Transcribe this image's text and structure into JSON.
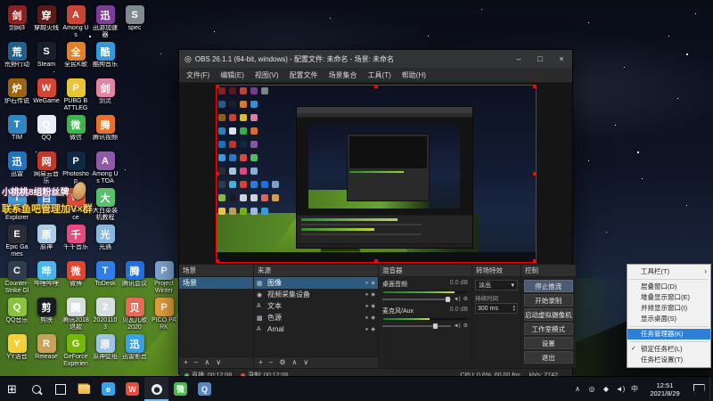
{
  "desktop": {
    "overlays": {
      "fan_badge": "小桃桃8组粉丝牌",
      "contact": "联系鱼吧管理加V×群"
    },
    "icons": [
      {
        "label": "剑网3",
        "color": "#8e2020",
        "col": 0,
        "row": 0
      },
      {
        "label": "穿越火线",
        "color": "#5b1a1a",
        "col": 1,
        "row": 0
      },
      {
        "label": "Among Us",
        "color": "#c74634",
        "col": 2,
        "row": 0
      },
      {
        "label": "迅游加速器",
        "color": "#7d3c98",
        "col": 3,
        "row": 0
      },
      {
        "label": "spec",
        "color": "#7f8c8d",
        "col": 4,
        "row": 0
      },
      {
        "label": "荒野行动",
        "color": "#1f618d",
        "col": 0,
        "row": 1
      },
      {
        "label": "Steam",
        "color": "#17202a",
        "col": 1,
        "row": 1
      },
      {
        "label": "全民K歌",
        "color": "#e67e22",
        "col": 2,
        "row": 1
      },
      {
        "label": "酷狗音乐",
        "color": "#3498db",
        "col": 3,
        "row": 1
      },
      {
        "label": "炉石传说",
        "color": "#9c640c",
        "col": 0,
        "row": 2
      },
      {
        "label": "WeGame",
        "color": "#d64533",
        "col": 1,
        "row": 2
      },
      {
        "label": "PUBG BATTLEGROUNDS",
        "color": "#e8c531",
        "col": 2,
        "row": 2
      },
      {
        "label": "剑灵",
        "color": "#e584a2",
        "col": 3,
        "row": 2
      },
      {
        "label": "TIM",
        "color": "#2e86c1",
        "col": 0,
        "row": 3
      },
      {
        "label": "QQ",
        "color": "#e8eef5",
        "col": 1,
        "row": 3
      },
      {
        "label": "微信",
        "color": "#3cb54a",
        "col": 2,
        "row": 3
      },
      {
        "label": "腾讯视频",
        "color": "#e8702a",
        "col": 3,
        "row": 3
      },
      {
        "label": "迅雷",
        "color": "#1f74c0",
        "col": 0,
        "row": 4
      },
      {
        "label": "网易云音乐",
        "color": "#c0392b",
        "col": 1,
        "row": 4
      },
      {
        "label": "Photoshop",
        "color": "#0d2a44",
        "col": 2,
        "row": 4
      },
      {
        "label": "Among Us TOA",
        "color": "#8e5aa8",
        "col": 3,
        "row": 4
      },
      {
        "label": "Internet Explorer",
        "color": "#3da0e0",
        "col": 0,
        "row": 5
      },
      {
        "label": "百度网盘",
        "color": "#2980d0",
        "col": 1,
        "row": 5
      },
      {
        "label": "WPS Office",
        "color": "#e74c3c",
        "col": 2,
        "row": 5
      },
      {
        "label": "大白菜装机教程",
        "color": "#58c06d",
        "col": 3,
        "row": 5
      },
      {
        "label": "Epic Games",
        "color": "#2c2c34",
        "col": 0,
        "row": 6
      },
      {
        "label": "原神",
        "color": "#aecbe8",
        "col": 1,
        "row": 6
      },
      {
        "label": "千千音乐",
        "color": "#e84a7f",
        "col": 2,
        "row": 6
      },
      {
        "label": "光遇",
        "color": "#88b8e0",
        "col": 3,
        "row": 6
      },
      {
        "label": "Counter-Strike Global Off...",
        "color": "#2f3d4c",
        "col": 0,
        "row": 7
      },
      {
        "label": "哔哩哔哩",
        "color": "#4cb5e8",
        "col": 1,
        "row": 7
      },
      {
        "label": "微博",
        "color": "#e6432e",
        "col": 2,
        "row": 7
      },
      {
        "label": "ToDesk",
        "color": "#2e7fe8",
        "col": 3,
        "row": 7
      },
      {
        "label": "腾讯会议",
        "color": "#1d72e8",
        "col": 4,
        "row": 7
      },
      {
        "label": "Project Winter",
        "color": "#7fa8d5",
        "col": 5,
        "row": 7
      },
      {
        "label": "QQ音乐",
        "color": "#8ac43f",
        "col": 0,
        "row": 8
      },
      {
        "label": "剪映",
        "color": "#1a1a22",
        "col": 1,
        "row": 8
      },
      {
        "label": "腾讯2018退款",
        "color": "#d8dde2",
        "col": 2,
        "row": 8
      },
      {
        "label": "20201103",
        "color": "#d8dde2",
        "col": 3,
        "row": 8
      },
      {
        "label": "贝瓦儿歌2020",
        "color": "#e86a5a",
        "col": 4,
        "row": 8
      },
      {
        "label": "PICO PARK",
        "color": "#e8a23f",
        "col": 5,
        "row": 8
      },
      {
        "label": "YY语音",
        "color": "#f7d038",
        "col": 0,
        "row": 9
      },
      {
        "label": "Release",
        "color": "#c8a25a",
        "col": 1,
        "row": 9
      },
      {
        "label": "GeForce Experience",
        "color": "#76b900",
        "col": 2,
        "row": 9
      },
      {
        "label": "原神壁纸",
        "color": "#9fc4e8",
        "col": 3,
        "row": 9
      },
      {
        "label": "迅雷影音",
        "color": "#3aa0e8",
        "col": 4,
        "row": 9
      }
    ]
  },
  "obs": {
    "logo": "◎",
    "title": "OBS 26.1.1 (64-bit, windows) - 配置文件: 未命名 - 场景: 未命名",
    "window_buttons": {
      "min": "–",
      "max": "□",
      "close": "×"
    },
    "menus": [
      "文件(F)",
      "编辑(E)",
      "视图(V)",
      "配置文件",
      "场景集合",
      "工具(T)",
      "帮助(H)"
    ],
    "scenes": {
      "title": "场景",
      "items": [
        "场景"
      ],
      "selected": 0,
      "toolbar": [
        {
          "glyph": "+",
          "name": "add-scene-button"
        },
        {
          "glyph": "−",
          "name": "remove-scene-button"
        },
        {
          "glyph": "∧",
          "name": "move-scene-up-button"
        },
        {
          "glyph": "∨",
          "name": "move-scene-down-button"
        }
      ]
    },
    "sources": {
      "title": "来源",
      "eye": "●",
      "lock": "◆",
      "selected": 0,
      "items": [
        {
          "name": "图像",
          "glyph": "▦"
        },
        {
          "name": "视频采集设备",
          "glyph": "◉"
        },
        {
          "name": "文本",
          "glyph": "A"
        },
        {
          "name": "色源",
          "glyph": "▩"
        },
        {
          "name": "Arnal",
          "glyph": "A"
        }
      ],
      "toolbar": [
        {
          "glyph": "+",
          "name": "add-source-button"
        },
        {
          "glyph": "−",
          "name": "remove-source-button"
        },
        {
          "glyph": "⚙",
          "name": "source-properties-button"
        },
        {
          "glyph": "∧",
          "name": "move-source-up-button"
        },
        {
          "glyph": "∨",
          "name": "move-source-down-button"
        }
      ]
    },
    "mixer": {
      "title": "混音器",
      "speaker": "◄)",
      "gear": "⚙",
      "channels": [
        {
          "name": "桌面音频",
          "db": "0.0 dB",
          "meter": 85,
          "slider": 97
        },
        {
          "name": "麦克风/Aux",
          "db": "0.0 dB",
          "meter": 55,
          "slider": 78
        }
      ]
    },
    "transitions": {
      "title": "转场特效",
      "transition": "淡出",
      "select_arrow": "▾",
      "duration_label": "持续时间",
      "duration": "300 ms",
      "spin_up": "▴",
      "spin_down": "▾"
    },
    "controls": {
      "title": "控制",
      "buttons": [
        {
          "label": "停止推流",
          "name": "stop-streaming-button",
          "active": true
        },
        {
          "label": "开始录制",
          "name": "start-recording-button",
          "active": false
        },
        {
          "label": "启动虚拟摄像机",
          "name": "start-virtual-camera-button",
          "active": false
        },
        {
          "label": "工作室模式",
          "name": "studio-mode-button",
          "active": false
        },
        {
          "label": "设置",
          "name": "settings-button",
          "active": false
        },
        {
          "label": "退出",
          "name": "exit-button",
          "active": false
        }
      ]
    },
    "statusbar": [
      {
        "text": "直播: 00:12:08",
        "dot": "#2ecc71",
        "name": "status-live"
      },
      {
        "text": "录制: 00:12:08",
        "dot": "#e74c3c",
        "name": "status-rec"
      },
      {
        "text": "CPU: 0.6%, 60.00 fps",
        "name": "status-cpu-fps"
      },
      {
        "text": "kb/s: 2742",
        "name": "status-bitrate"
      }
    ]
  },
  "context_menu": {
    "items": [
      {
        "label": "工具栏(T)",
        "submenu": true
      },
      {
        "sep": true
      },
      {
        "label": "层叠窗口(D)"
      },
      {
        "label": "堆叠显示窗口(E)"
      },
      {
        "label": "并排显示窗口(I)"
      },
      {
        "label": "显示桌面(S)"
      },
      {
        "sep": true
      },
      {
        "label": "任务管理器(K)",
        "highlighted": true
      },
      {
        "sep": true
      },
      {
        "label": "锁定任务栏(L)",
        "checked": true
      },
      {
        "label": "任务栏设置(T)"
      }
    ]
  },
  "taskbar": {
    "start_glyph": "⊞",
    "apps": [
      {
        "name": "search"
      },
      {
        "name": "task-view"
      },
      {
        "name": "file-explorer"
      },
      {
        "name": "edge",
        "letter": "e",
        "color": "#3aa0e8"
      },
      {
        "name": "wegame",
        "letter": "W",
        "color": "#e64a3c"
      },
      {
        "name": "obs",
        "active": true
      },
      {
        "name": "wechat",
        "letter": "微",
        "color": "#43c04a"
      },
      {
        "name": "qq",
        "letter": "Q",
        "color": "#5a87c0"
      }
    ],
    "tray": [
      {
        "name": "hidden-icons",
        "glyph": "∧"
      },
      {
        "name": "obs-tray",
        "glyph": "◎"
      },
      {
        "name": "nvidia-tray",
        "glyph": "◆"
      },
      {
        "name": "volume",
        "glyph": "◄)"
      },
      {
        "name": "ime-chinese",
        "glyph": "中"
      }
    ],
    "clock": {
      "time": "12:51",
      "date": "2021/8/29"
    }
  }
}
